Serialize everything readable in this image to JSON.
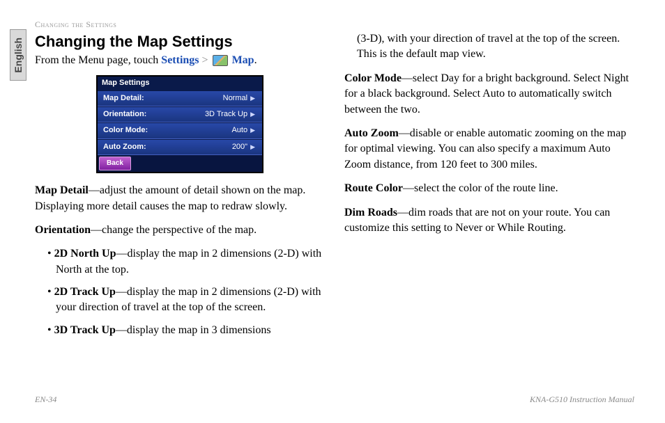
{
  "headerLabel": "Changing the Settings",
  "langTab": "English",
  "title": "Changing the Map Settings",
  "breadcrumb": {
    "prefix": "From the Menu page, touch ",
    "settings": "Settings",
    "gt": " > ",
    "map": "Map",
    "period": "."
  },
  "screenshot": {
    "title": "Map Settings",
    "rows": [
      {
        "label": "Map Detail:",
        "value": "Normal"
      },
      {
        "label": "Orientation:",
        "value": "3D Track Up"
      },
      {
        "label": "Color Mode:",
        "value": "Auto"
      },
      {
        "label": "Auto Zoom:",
        "value": "200\""
      }
    ],
    "back": "Back"
  },
  "mapDetail": {
    "term": "Map Detail",
    "desc": "—adjust the amount of detail shown on the map. Displaying more detail causes the map to redraw slowly."
  },
  "orientation": {
    "term": "Orientation",
    "desc": "—change the perspective of the map."
  },
  "orientItems": [
    {
      "term": "2D North Up",
      "desc": "—display the map in 2 dimensions (2-D) with North at the top."
    },
    {
      "term": "2D Track Up",
      "desc": "—display the map in 2 dimensions (2-D) with your direction of travel at the top of the screen."
    },
    {
      "term": "3D Track Up",
      "desc": "—display the map in 3 dimensions "
    }
  ],
  "col2top": "(3-D), with your direction of travel at the top of the screen. This is the default map view.",
  "colorMode": {
    "term": "Color Mode",
    "desc": "—select Day for a bright background. Select Night for a black background. Select Auto to automatically switch between the two."
  },
  "autoZoom": {
    "term": "Auto Zoom",
    "desc": "—disable or enable automatic zooming on the map for optimal viewing. You can also specify a maximum Auto Zoom distance, from 120 feet to 300 miles."
  },
  "routeColor": {
    "term": "Route Color",
    "desc": "—select the color of the route line."
  },
  "dimRoads": {
    "term": "Dim Roads",
    "desc": "—dim roads that are not on your route. You can customize this setting to Never or While Routing."
  },
  "footer": {
    "page": "EN-34",
    "manual": "KNA-G510 Instruction Manual"
  }
}
